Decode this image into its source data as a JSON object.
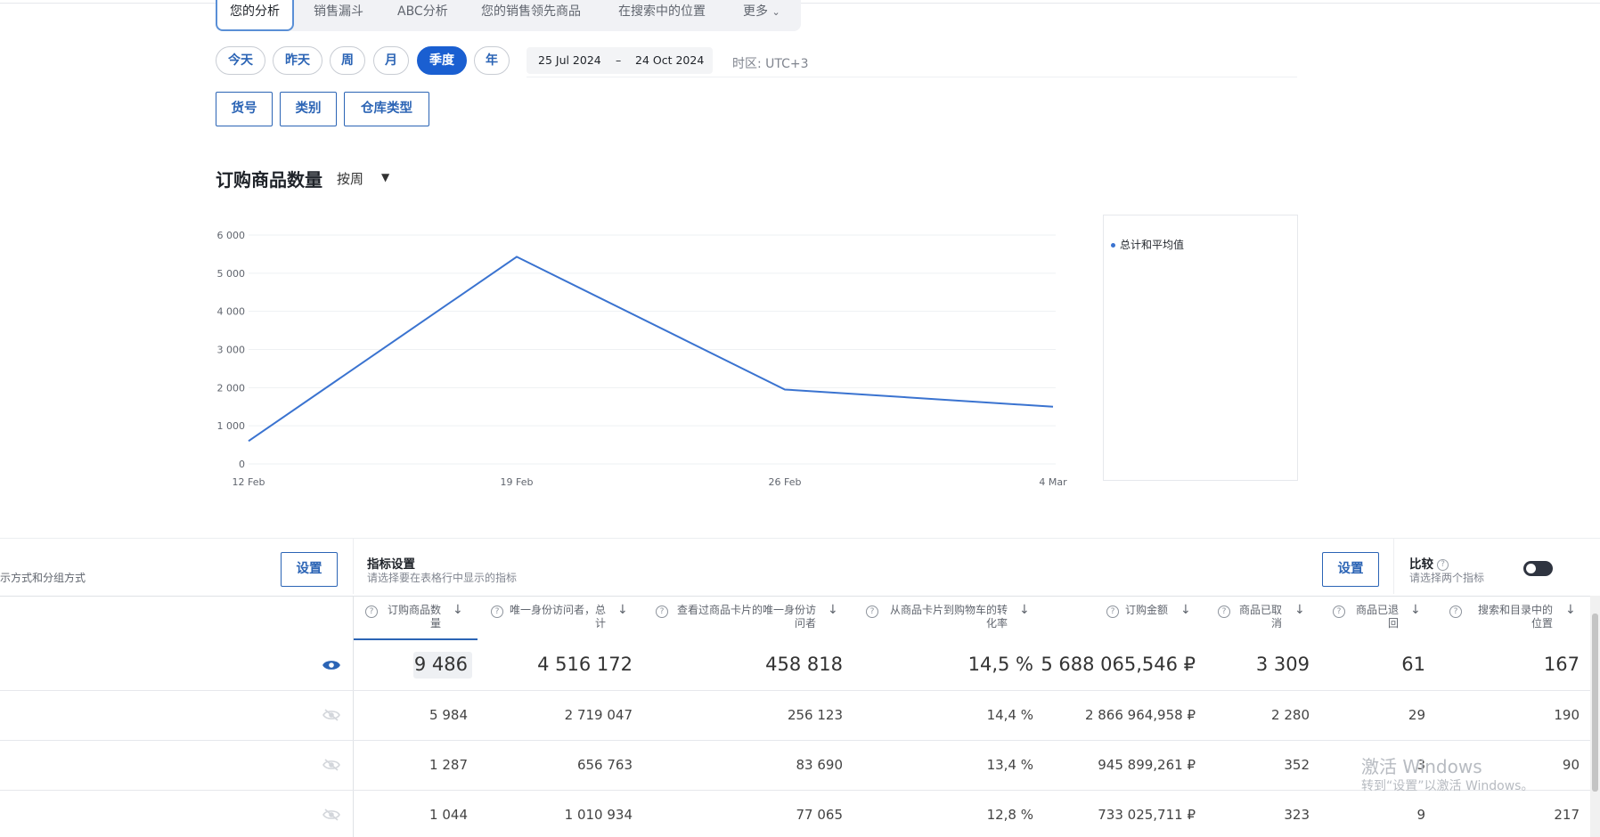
{
  "tabs": {
    "items": [
      "您的分析",
      "销售漏斗",
      "ABC分析",
      "您的销售领先商品",
      "在搜索中的位置",
      "更多"
    ],
    "active": 0
  },
  "period": {
    "pills": [
      "今天",
      "昨天",
      "周",
      "月",
      "季度",
      "年"
    ],
    "active": 4,
    "date_from": "25 Jul 2024",
    "date_sep": "–",
    "date_to": "24 Oct 2024",
    "timezone": "时区:   UTC+3"
  },
  "filters": [
    "货号",
    "类别",
    "仓库类型"
  ],
  "chart_section": {
    "title": "订购商品数量",
    "group_by": "按周"
  },
  "chart_data": {
    "type": "line",
    "title": "",
    "xlabel": "",
    "ylabel": "",
    "x": [
      "12 Feb",
      "19 Feb",
      "26 Feb",
      "4 Mar"
    ],
    "y_ticks": [
      "0",
      "1 000",
      "2 000",
      "3 000",
      "4 000",
      "5 000",
      "6 000"
    ],
    "ylim": [
      0,
      6000
    ],
    "series": [
      {
        "name": "总计和平均值",
        "values": [
          600,
          5430,
          1950,
          1500
        ],
        "color": "#3a73d0"
      }
    ],
    "grid": true,
    "legend": "right"
  },
  "table_settings": {
    "left_hint": "示方式和分组方式",
    "settings_label": "设置",
    "metrics_title": "指标设置",
    "metrics_sub": "请选择要在表格行中显示的指标",
    "settings_label_2": "设置",
    "compare_title": "比较",
    "compare_sub": "请选择两个指标",
    "compare_enabled": false
  },
  "table": {
    "headers": [
      [
        "订购商品数",
        "量"
      ],
      [
        "唯一身份访问者，总",
        "计"
      ],
      [
        "查看过商品卡片的唯一身份访",
        "问者"
      ],
      [
        "从商品卡片到购物车的转",
        "化率"
      ],
      [
        "订购金额",
        ""
      ],
      [
        "商品已取",
        "消"
      ],
      [
        "商品已退",
        "回"
      ],
      [
        "搜索和目录中的",
        "位置"
      ]
    ],
    "rows": [
      [
        "9 486",
        "4 516 172",
        "458 818",
        "14,5 %",
        "5 688 065,546 ₽",
        "3 309",
        "61",
        "167"
      ],
      [
        "5 984",
        "2 719 047",
        "256 123",
        "14,4 %",
        "2 866 964,958 ₽",
        "2 280",
        "29",
        "190"
      ],
      [
        "1 287",
        "656 763",
        "83 690",
        "13,4 %",
        "945 899,261 ₽",
        "352",
        "3",
        "90"
      ],
      [
        "1 044",
        "1 010 934",
        "77 065",
        "12,8 %",
        "733 025,711 ₽",
        "323",
        "9",
        "217"
      ]
    ]
  },
  "watermark": {
    "line1": "激活 Windows",
    "line2": "转到“设置”以激活 Windows。"
  }
}
